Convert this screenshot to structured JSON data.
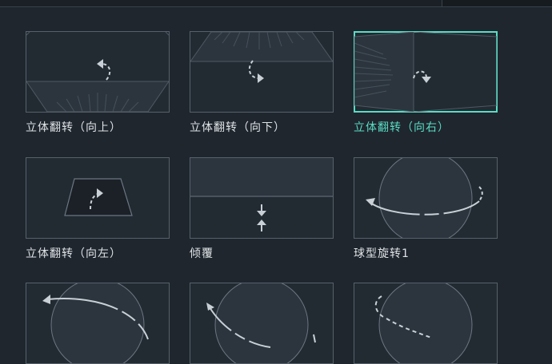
{
  "colors": {
    "background": "#1f262e",
    "tile_border": "#57606a",
    "selected_accent": "#59dcc4",
    "label_text": "#dfe3e6",
    "glyph": "#c9d0d6"
  },
  "transitions": [
    {
      "label": "立体翻转（向上）",
      "icon": "cube-flip-up-icon",
      "selected": false
    },
    {
      "label": "立体翻转（向下）",
      "icon": "cube-flip-down-icon",
      "selected": false
    },
    {
      "label": "立体翻转（向右）",
      "icon": "cube-flip-right-icon",
      "selected": true
    },
    {
      "label": "立体翻转（向左）",
      "icon": "cube-flip-left-icon",
      "selected": false
    },
    {
      "label": "倾覆",
      "icon": "topple-icon",
      "selected": false
    },
    {
      "label": "球型旋转1",
      "icon": "sphere-rotate-icon",
      "selected": false
    },
    {
      "label": "",
      "icon": "sphere-rotate-icon",
      "selected": false
    },
    {
      "label": "",
      "icon": "sphere-rotate-icon",
      "selected": false
    },
    {
      "label": "",
      "icon": "sphere-rotate-icon",
      "selected": false
    }
  ]
}
